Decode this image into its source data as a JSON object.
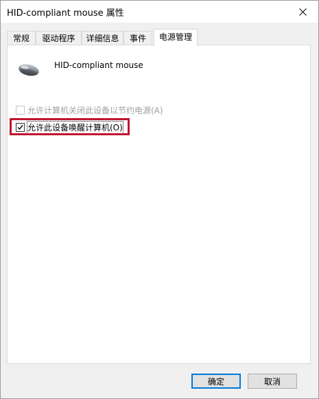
{
  "window": {
    "title": "HID-compliant mouse 属性"
  },
  "tabs": [
    {
      "label": "常规"
    },
    {
      "label": "驱动程序"
    },
    {
      "label": "详细信息"
    },
    {
      "label": "事件"
    },
    {
      "label": "电源管理",
      "active": true
    }
  ],
  "device": {
    "name": "HID-compliant mouse",
    "icon": "mouse-icon"
  },
  "options": {
    "allow_power_off": {
      "label": "允许计算机关闭此设备以节约电源(A)",
      "checked": false,
      "enabled": false
    },
    "allow_wake": {
      "label": "允许此设备唤醒计算机(O)",
      "checked": true,
      "enabled": true
    }
  },
  "buttons": {
    "ok": "确定",
    "cancel": "取消"
  },
  "colors": {
    "highlight": "#c0142e",
    "default_button_border": "#0078d7"
  }
}
